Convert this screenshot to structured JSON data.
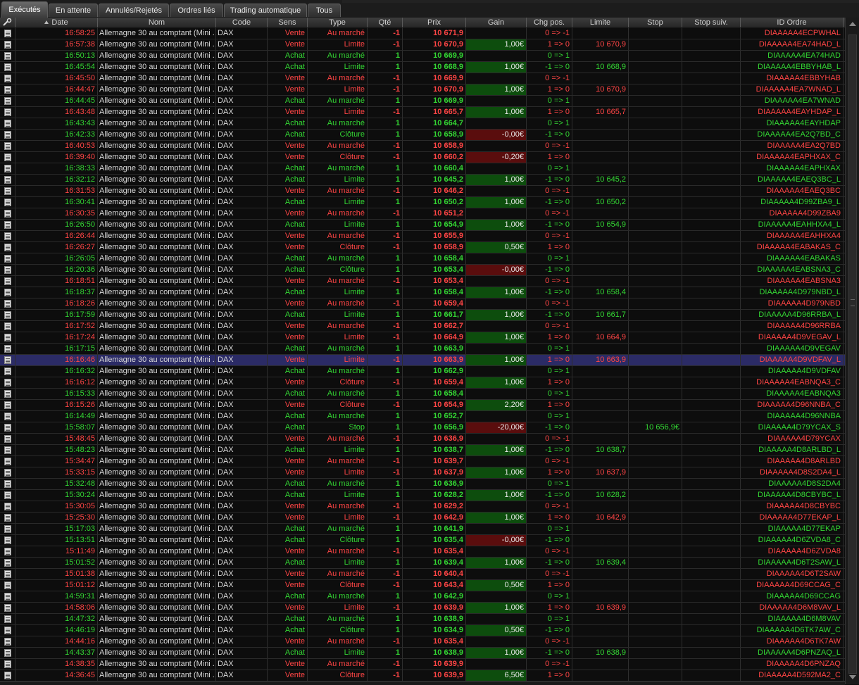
{
  "tabs": [
    {
      "label": "Exécutés",
      "active": true
    },
    {
      "label": "En attente",
      "active": false
    },
    {
      "label": "Annulés/Rejetés",
      "active": false
    },
    {
      "label": "Ordres liés",
      "active": false
    },
    {
      "label": "Trading automatique",
      "active": false
    },
    {
      "label": "Tous",
      "active": false
    }
  ],
  "columns": [
    "",
    "Date",
    "Nom",
    "Code",
    "Sens",
    "Type",
    "Qté",
    "Prix",
    "Gain",
    "Chg pos.",
    "Limite",
    "Stop",
    "Stop suiv.",
    "ID Ordre"
  ],
  "icons": {
    "settings": "wrench-icon",
    "row": "document-icon",
    "sort": "sort-ascending-icon"
  },
  "colors": {
    "buy": "#33d633",
    "sell": "#ff4545",
    "gain_positive_bg": "#0d4d0d",
    "gain_negative_bg": "#5a0d0d",
    "selected_row": "#2b2b66"
  },
  "selected_row_index": 29,
  "rows": [
    [
      "16:58:25",
      "Allemagne 30 au comptant (Mini ...",
      "DAX",
      "Vente",
      "Au marché",
      "-1",
      "10 671,9",
      "",
      "0 => -1",
      "",
      "",
      "",
      "DIAAAAA4ECPWHAL"
    ],
    [
      "16:57:38",
      "Allemagne 30 au comptant (Mini ...",
      "DAX",
      "Vente",
      "Limite",
      "-1",
      "10 670,9",
      "1,00€",
      "1 => 0",
      "10 670,9",
      "",
      "",
      "DIAAAAA4EA74HAD_L"
    ],
    [
      "16:50:13",
      "Allemagne 30 au comptant (Mini ...",
      "DAX",
      "Achat",
      "Au marché",
      "1",
      "10 669,9",
      "",
      "0 => 1",
      "",
      "",
      "",
      "DIAAAAA4EA74HAD"
    ],
    [
      "16:45:54",
      "Allemagne 30 au comptant (Mini ...",
      "DAX",
      "Achat",
      "Limite",
      "1",
      "10 668,9",
      "1,00€",
      "-1 => 0",
      "10 668,9",
      "",
      "",
      "DIAAAAA4EBBYHAB_L"
    ],
    [
      "16:45:50",
      "Allemagne 30 au comptant (Mini ...",
      "DAX",
      "Vente",
      "Au marché",
      "-1",
      "10 669,9",
      "",
      "0 => -1",
      "",
      "",
      "",
      "DIAAAAA4EBBYHAB"
    ],
    [
      "16:44:47",
      "Allemagne 30 au comptant (Mini ...",
      "DAX",
      "Vente",
      "Limite",
      "-1",
      "10 670,9",
      "1,00€",
      "1 => 0",
      "10 670,9",
      "",
      "",
      "DIAAAAA4EA7WNAD_L"
    ],
    [
      "16:44:45",
      "Allemagne 30 au comptant (Mini ...",
      "DAX",
      "Achat",
      "Au marché",
      "1",
      "10 669,9",
      "",
      "0 => 1",
      "",
      "",
      "",
      "DIAAAAA4EA7WNAD"
    ],
    [
      "16:43:48",
      "Allemagne 30 au comptant (Mini ...",
      "DAX",
      "Vente",
      "Limite",
      "-1",
      "10 665,7",
      "1,00€",
      "1 => 0",
      "10 665,7",
      "",
      "",
      "DIAAAAA4EAYHDAP_L"
    ],
    [
      "16:43:43",
      "Allemagne 30 au comptant (Mini ...",
      "DAX",
      "Achat",
      "Au marché",
      "1",
      "10 664,7",
      "",
      "0 => 1",
      "",
      "",
      "",
      "DIAAAAA4EAYHDAP"
    ],
    [
      "16:42:33",
      "Allemagne 30 au comptant (Mini ...",
      "DAX",
      "Achat",
      "Clôture",
      "1",
      "10 658,9",
      "-0,00€",
      "-1 => 0",
      "",
      "",
      "",
      "DIAAAAA4EA2Q7BD_C"
    ],
    [
      "16:40:53",
      "Allemagne 30 au comptant (Mini ...",
      "DAX",
      "Vente",
      "Au marché",
      "-1",
      "10 658,9",
      "",
      "0 => -1",
      "",
      "",
      "",
      "DIAAAAA4EA2Q7BD"
    ],
    [
      "16:39:40",
      "Allemagne 30 au comptant (Mini ...",
      "DAX",
      "Vente",
      "Clôture",
      "-1",
      "10 660,2",
      "-0,20€",
      "1 => 0",
      "",
      "",
      "",
      "DIAAAAA4EAPHXAX_C"
    ],
    [
      "16:38:33",
      "Allemagne 30 au comptant (Mini ...",
      "DAX",
      "Achat",
      "Au marché",
      "1",
      "10 660,4",
      "",
      "0 => 1",
      "",
      "",
      "",
      "DIAAAAA4EAPHXAX"
    ],
    [
      "16:32:12",
      "Allemagne 30 au comptant (Mini ...",
      "DAX",
      "Achat",
      "Limite",
      "1",
      "10 645,2",
      "1,00€",
      "-1 => 0",
      "10 645,2",
      "",
      "",
      "DIAAAAA4EAEQ3BC_L"
    ],
    [
      "16:31:53",
      "Allemagne 30 au comptant (Mini ...",
      "DAX",
      "Vente",
      "Au marché",
      "-1",
      "10 646,2",
      "",
      "0 => -1",
      "",
      "",
      "",
      "DIAAAAA4EAEQ3BC"
    ],
    [
      "16:30:41",
      "Allemagne 30 au comptant (Mini ...",
      "DAX",
      "Achat",
      "Limite",
      "1",
      "10 650,2",
      "1,00€",
      "-1 => 0",
      "10 650,2",
      "",
      "",
      "DIAAAAA4D99ZBA9_L"
    ],
    [
      "16:30:35",
      "Allemagne 30 au comptant (Mini ...",
      "DAX",
      "Vente",
      "Au marché",
      "-1",
      "10 651,2",
      "",
      "0 => -1",
      "",
      "",
      "",
      "DIAAAAA4D99ZBA9"
    ],
    [
      "16:26:50",
      "Allemagne 30 au comptant (Mini ...",
      "DAX",
      "Achat",
      "Limite",
      "1",
      "10 654,9",
      "1,00€",
      "-1 => 0",
      "10 654,9",
      "",
      "",
      "DIAAAAA4EAHHXA4_L"
    ],
    [
      "16:26:44",
      "Allemagne 30 au comptant (Mini ...",
      "DAX",
      "Vente",
      "Au marché",
      "-1",
      "10 655,9",
      "",
      "0 => -1",
      "",
      "",
      "",
      "DIAAAAA4EAHHXA4"
    ],
    [
      "16:26:27",
      "Allemagne 30 au comptant (Mini ...",
      "DAX",
      "Vente",
      "Clôture",
      "-1",
      "10 658,9",
      "0,50€",
      "1 => 0",
      "",
      "",
      "",
      "DIAAAAA4EABAKAS_C"
    ],
    [
      "16:26:05",
      "Allemagne 30 au comptant (Mini ...",
      "DAX",
      "Achat",
      "Au marché",
      "1",
      "10 658,4",
      "",
      "0 => 1",
      "",
      "",
      "",
      "DIAAAAA4EABAKAS"
    ],
    [
      "16:20:36",
      "Allemagne 30 au comptant (Mini ...",
      "DAX",
      "Achat",
      "Clôture",
      "1",
      "10 653,4",
      "-0,00€",
      "-1 => 0",
      "",
      "",
      "",
      "DIAAAAA4EABSNA3_C"
    ],
    [
      "16:18:51",
      "Allemagne 30 au comptant (Mini ...",
      "DAX",
      "Vente",
      "Au marché",
      "-1",
      "10 653,4",
      "",
      "0 => -1",
      "",
      "",
      "",
      "DIAAAAA4EABSNA3"
    ],
    [
      "16:18:37",
      "Allemagne 30 au comptant (Mini ...",
      "DAX",
      "Achat",
      "Limite",
      "1",
      "10 658,4",
      "1,00€",
      "-1 => 0",
      "10 658,4",
      "",
      "",
      "DIAAAAA4D979NBD_L"
    ],
    [
      "16:18:26",
      "Allemagne 30 au comptant (Mini ...",
      "DAX",
      "Vente",
      "Au marché",
      "-1",
      "10 659,4",
      "",
      "0 => -1",
      "",
      "",
      "",
      "DIAAAAA4D979NBD"
    ],
    [
      "16:17:59",
      "Allemagne 30 au comptant (Mini ...",
      "DAX",
      "Achat",
      "Limite",
      "1",
      "10 661,7",
      "1,00€",
      "-1 => 0",
      "10 661,7",
      "",
      "",
      "DIAAAAA4D96RRBA_L"
    ],
    [
      "16:17:52",
      "Allemagne 30 au comptant (Mini ...",
      "DAX",
      "Vente",
      "Au marché",
      "-1",
      "10 662,7",
      "",
      "0 => -1",
      "",
      "",
      "",
      "DIAAAAA4D96RRBA"
    ],
    [
      "16:17:24",
      "Allemagne 30 au comptant (Mini ...",
      "DAX",
      "Vente",
      "Limite",
      "-1",
      "10 664,9",
      "1,00€",
      "1 => 0",
      "10 664,9",
      "",
      "",
      "DIAAAAA4D9VEGAV_L"
    ],
    [
      "16:17:15",
      "Allemagne 30 au comptant (Mini ...",
      "DAX",
      "Achat",
      "Au marché",
      "1",
      "10 663,9",
      "",
      "0 => 1",
      "",
      "",
      "",
      "DIAAAAA4D9VEGAV"
    ],
    [
      "16:16:46",
      "Allemagne 30 au comptant (Mini ...",
      "DAX",
      "Vente",
      "Limite",
      "-1",
      "10 663,9",
      "1,00€",
      "1 => 0",
      "10 663,9",
      "",
      "",
      "DIAAAAA4D9VDFAV_L"
    ],
    [
      "16:16:32",
      "Allemagne 30 au comptant (Mini ...",
      "DAX",
      "Achat",
      "Au marché",
      "1",
      "10 662,9",
      "",
      "0 => 1",
      "",
      "",
      "",
      "DIAAAAA4D9VDFAV"
    ],
    [
      "16:16:12",
      "Allemagne 30 au comptant (Mini ...",
      "DAX",
      "Vente",
      "Clôture",
      "-1",
      "10 659,4",
      "1,00€",
      "1 => 0",
      "",
      "",
      "",
      "DIAAAAA4EABNQA3_C"
    ],
    [
      "16:15:33",
      "Allemagne 30 au comptant (Mini ...",
      "DAX",
      "Achat",
      "Au marché",
      "1",
      "10 658,4",
      "",
      "0 => 1",
      "",
      "",
      "",
      "DIAAAAA4EABNQA3"
    ],
    [
      "16:15:26",
      "Allemagne 30 au comptant (Mini ...",
      "DAX",
      "Vente",
      "Clôture",
      "-1",
      "10 654,9",
      "2,20€",
      "1 => 0",
      "",
      "",
      "",
      "DIAAAAA4D96NNBA_C"
    ],
    [
      "16:14:49",
      "Allemagne 30 au comptant (Mini ...",
      "DAX",
      "Achat",
      "Au marché",
      "1",
      "10 652,7",
      "",
      "0 => 1",
      "",
      "",
      "",
      "DIAAAAA4D96NNBA"
    ],
    [
      "15:58:07",
      "Allemagne 30 au comptant (Mini ...",
      "DAX",
      "Achat",
      "Stop",
      "1",
      "10 656,9",
      "-20,00€",
      "-1 => 0",
      "",
      "10 656,9€",
      "",
      "DIAAAAA4D79YCAX_S"
    ],
    [
      "15:48:45",
      "Allemagne 30 au comptant (Mini ...",
      "DAX",
      "Vente",
      "Au marché",
      "-1",
      "10 636,9",
      "",
      "0 => -1",
      "",
      "",
      "",
      "DIAAAAA4D79YCAX"
    ],
    [
      "15:48:23",
      "Allemagne 30 au comptant (Mini ...",
      "DAX",
      "Achat",
      "Limite",
      "1",
      "10 638,7",
      "1,00€",
      "-1 => 0",
      "10 638,7",
      "",
      "",
      "DIAAAAA4D8ARLBD_L"
    ],
    [
      "15:34:47",
      "Allemagne 30 au comptant (Mini ...",
      "DAX",
      "Vente",
      "Au marché",
      "-1",
      "10 639,7",
      "",
      "0 => -1",
      "",
      "",
      "",
      "DIAAAAA4D8ARLBD"
    ],
    [
      "15:33:15",
      "Allemagne 30 au comptant (Mini ...",
      "DAX",
      "Vente",
      "Limite",
      "-1",
      "10 637,9",
      "1,00€",
      "1 => 0",
      "10 637,9",
      "",
      "",
      "DIAAAAA4D8S2DA4_L"
    ],
    [
      "15:32:48",
      "Allemagne 30 au comptant (Mini ...",
      "DAX",
      "Achat",
      "Au marché",
      "1",
      "10 636,9",
      "",
      "0 => 1",
      "",
      "",
      "",
      "DIAAAAA4D8S2DA4"
    ],
    [
      "15:30:24",
      "Allemagne 30 au comptant (Mini ...",
      "DAX",
      "Achat",
      "Limite",
      "1",
      "10 628,2",
      "1,00€",
      "-1 => 0",
      "10 628,2",
      "",
      "",
      "DIAAAAA4D8CBYBC_L"
    ],
    [
      "15:30:05",
      "Allemagne 30 au comptant (Mini ...",
      "DAX",
      "Vente",
      "Au marché",
      "-1",
      "10 629,2",
      "",
      "0 => -1",
      "",
      "",
      "",
      "DIAAAAA4D8CBYBC"
    ],
    [
      "15:25:30",
      "Allemagne 30 au comptant (Mini ...",
      "DAX",
      "Vente",
      "Limite",
      "-1",
      "10 642,9",
      "1,00€",
      "1 => 0",
      "10 642,9",
      "",
      "",
      "DIAAAAA4D77EKAP_L"
    ],
    [
      "15:17:03",
      "Allemagne 30 au comptant (Mini ...",
      "DAX",
      "Achat",
      "Au marché",
      "1",
      "10 641,9",
      "",
      "0 => 1",
      "",
      "",
      "",
      "DIAAAAA4D77EKAP"
    ],
    [
      "15:13:51",
      "Allemagne 30 au comptant (Mini ...",
      "DAX",
      "Achat",
      "Clôture",
      "1",
      "10 635,4",
      "-0,00€",
      "-1 => 0",
      "",
      "",
      "",
      "DIAAAAA4D6ZVDA8_C"
    ],
    [
      "15:11:49",
      "Allemagne 30 au comptant (Mini ...",
      "DAX",
      "Vente",
      "Au marché",
      "-1",
      "10 635,4",
      "",
      "0 => -1",
      "",
      "",
      "",
      "DIAAAAA4D6ZVDA8"
    ],
    [
      "15:01:52",
      "Allemagne 30 au comptant (Mini ...",
      "DAX",
      "Achat",
      "Limite",
      "1",
      "10 639,4",
      "1,00€",
      "-1 => 0",
      "10 639,4",
      "",
      "",
      "DIAAAAA4D6T2SAW_L"
    ],
    [
      "15:01:38",
      "Allemagne 30 au comptant (Mini ...",
      "DAX",
      "Vente",
      "Au marché",
      "-1",
      "10 640,4",
      "",
      "0 => -1",
      "",
      "",
      "",
      "DIAAAAA4D6T2SAW"
    ],
    [
      "15:01:12",
      "Allemagne 30 au comptant (Mini ...",
      "DAX",
      "Vente",
      "Clôture",
      "-1",
      "10 643,4",
      "0,50€",
      "1 => 0",
      "",
      "",
      "",
      "DIAAAAA4D69CCAG_C"
    ],
    [
      "14:59:31",
      "Allemagne 30 au comptant (Mini ...",
      "DAX",
      "Achat",
      "Au marché",
      "1",
      "10 642,9",
      "",
      "0 => 1",
      "",
      "",
      "",
      "DIAAAAA4D69CCAG"
    ],
    [
      "14:58:06",
      "Allemagne 30 au comptant (Mini ...",
      "DAX",
      "Vente",
      "Limite",
      "-1",
      "10 639,9",
      "1,00€",
      "1 => 0",
      "10 639,9",
      "",
      "",
      "DIAAAAA4D6M8VAV_L"
    ],
    [
      "14:47:32",
      "Allemagne 30 au comptant (Mini ...",
      "DAX",
      "Achat",
      "Au marché",
      "1",
      "10 638,9",
      "",
      "0 => 1",
      "",
      "",
      "",
      "DIAAAAA4D6M8VAV"
    ],
    [
      "14:46:19",
      "Allemagne 30 au comptant (Mini ...",
      "DAX",
      "Achat",
      "Clôture",
      "1",
      "10 634,9",
      "0,50€",
      "-1 => 0",
      "",
      "",
      "",
      "DIAAAAA4D6TK7AW_C"
    ],
    [
      "14:44:16",
      "Allemagne 30 au comptant (Mini ...",
      "DAX",
      "Vente",
      "Au marché",
      "-1",
      "10 635,4",
      "",
      "0 => -1",
      "",
      "",
      "",
      "DIAAAAA4D6TK7AW"
    ],
    [
      "14:43:37",
      "Allemagne 30 au comptant (Mini ...",
      "DAX",
      "Achat",
      "Limite",
      "1",
      "10 638,9",
      "1,00€",
      "-1 => 0",
      "10 638,9",
      "",
      "",
      "DIAAAAA4D6PNZAQ_L"
    ],
    [
      "14:38:35",
      "Allemagne 30 au comptant (Mini ...",
      "DAX",
      "Vente",
      "Au marché",
      "-1",
      "10 639,9",
      "",
      "0 => -1",
      "",
      "",
      "",
      "DIAAAAA4D6PNZAQ"
    ],
    [
      "14:36:45",
      "Allemagne 30 au comptant (Mini ...",
      "DAX",
      "Vente",
      "Clôture",
      "-1",
      "10 639,9",
      "6,50€",
      "1 => 0",
      "",
      "",
      "",
      "DIAAAAA4D592MA2_C"
    ]
  ]
}
